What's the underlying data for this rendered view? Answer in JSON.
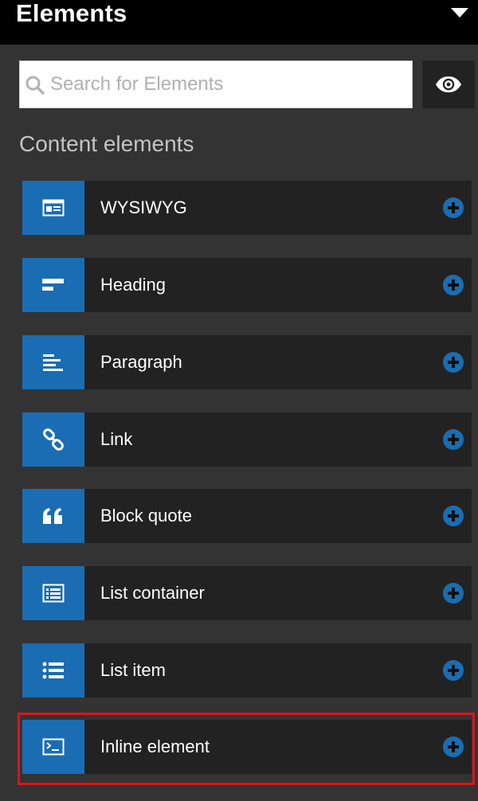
{
  "panel": {
    "title": "Elements"
  },
  "search": {
    "placeholder": "Search for Elements",
    "value": ""
  },
  "section": {
    "title": "Content elements"
  },
  "colors": {
    "accent": "#1a6db3",
    "header_bg": "#000000",
    "panel_bg": "#333333",
    "item_bg": "#222222",
    "highlight": "#d9151b"
  },
  "elements": [
    {
      "label": "WYSIWYG",
      "icon": "wysiwyg-icon"
    },
    {
      "label": "Heading",
      "icon": "heading-icon"
    },
    {
      "label": "Paragraph",
      "icon": "paragraph-icon"
    },
    {
      "label": "Link",
      "icon": "link-icon"
    },
    {
      "label": "Block quote",
      "icon": "quote-icon"
    },
    {
      "label": "List container",
      "icon": "list-container-icon"
    },
    {
      "label": "List item",
      "icon": "list-item-icon"
    },
    {
      "label": "Inline element",
      "icon": "inline-element-icon"
    }
  ]
}
